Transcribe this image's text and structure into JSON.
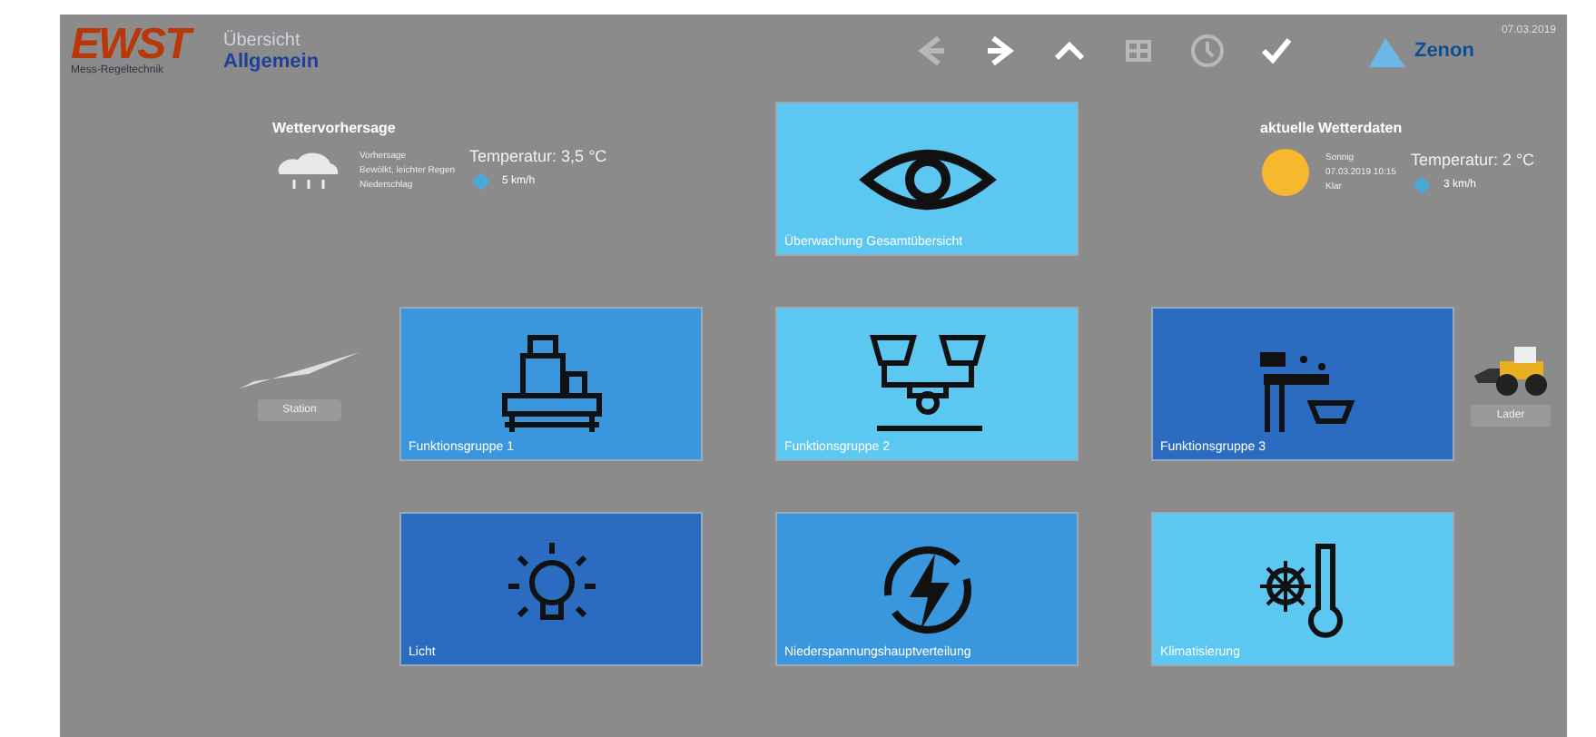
{
  "header": {
    "logo": "EWST",
    "logo_subtitle": "Mess-Regeltechnik",
    "breadcrumb": "Übersicht",
    "page_title": "Allgemein",
    "toolbar": [
      {
        "kind": "back",
        "disabled": true
      },
      {
        "kind": "forward",
        "disabled": false
      },
      {
        "kind": "up",
        "disabled": false
      },
      {
        "kind": "grid",
        "disabled": true
      },
      {
        "kind": "clock",
        "disabled": true
      },
      {
        "kind": "check",
        "disabled": false
      }
    ],
    "brand": "Zenon",
    "date": "07.03.2019"
  },
  "forecast": {
    "title": "Wettervorhersage",
    "kind": "cloud",
    "lines": [
      "Vorhersage",
      "Bewölkt, leichter Regen",
      "Niederschlag"
    ],
    "temperature": "Temperatur: 3,5 °C",
    "wind": "5 km/h"
  },
  "current": {
    "title": "aktuelle Wetterdaten",
    "kind": "sun",
    "lines": [
      "Sonnig",
      "07.03.2019 10:15",
      "Klar"
    ],
    "temperature": "Temperatur: 2 °C",
    "wind": "3 km/h"
  },
  "side_left": {
    "kind": "plane",
    "label": "Station"
  },
  "side_right": {
    "kind": "loader",
    "label": "Lader"
  },
  "tiles": [
    {
      "kind": "eye",
      "label": "Überwachung Gesamtübersicht",
      "color": "#5cc8f2"
    },
    {
      "kind": "machine",
      "label": "Funktionsgruppe 1",
      "color": "#3a97dd"
    },
    {
      "kind": "press",
      "label": "Funktionsgruppe 2",
      "color": "#5cc8f2"
    },
    {
      "kind": "conveyor",
      "label": "Funktionsgruppe 3",
      "color": "#2b6cc0"
    },
    {
      "kind": "bulb",
      "label": "Licht",
      "color": "#2b6cc0"
    },
    {
      "kind": "power",
      "label": "Niederspannungshauptverteilung",
      "color": "#3a97dd"
    },
    {
      "kind": "thermo",
      "label": "Klimatisierung",
      "color": "#5cc8f2"
    }
  ]
}
